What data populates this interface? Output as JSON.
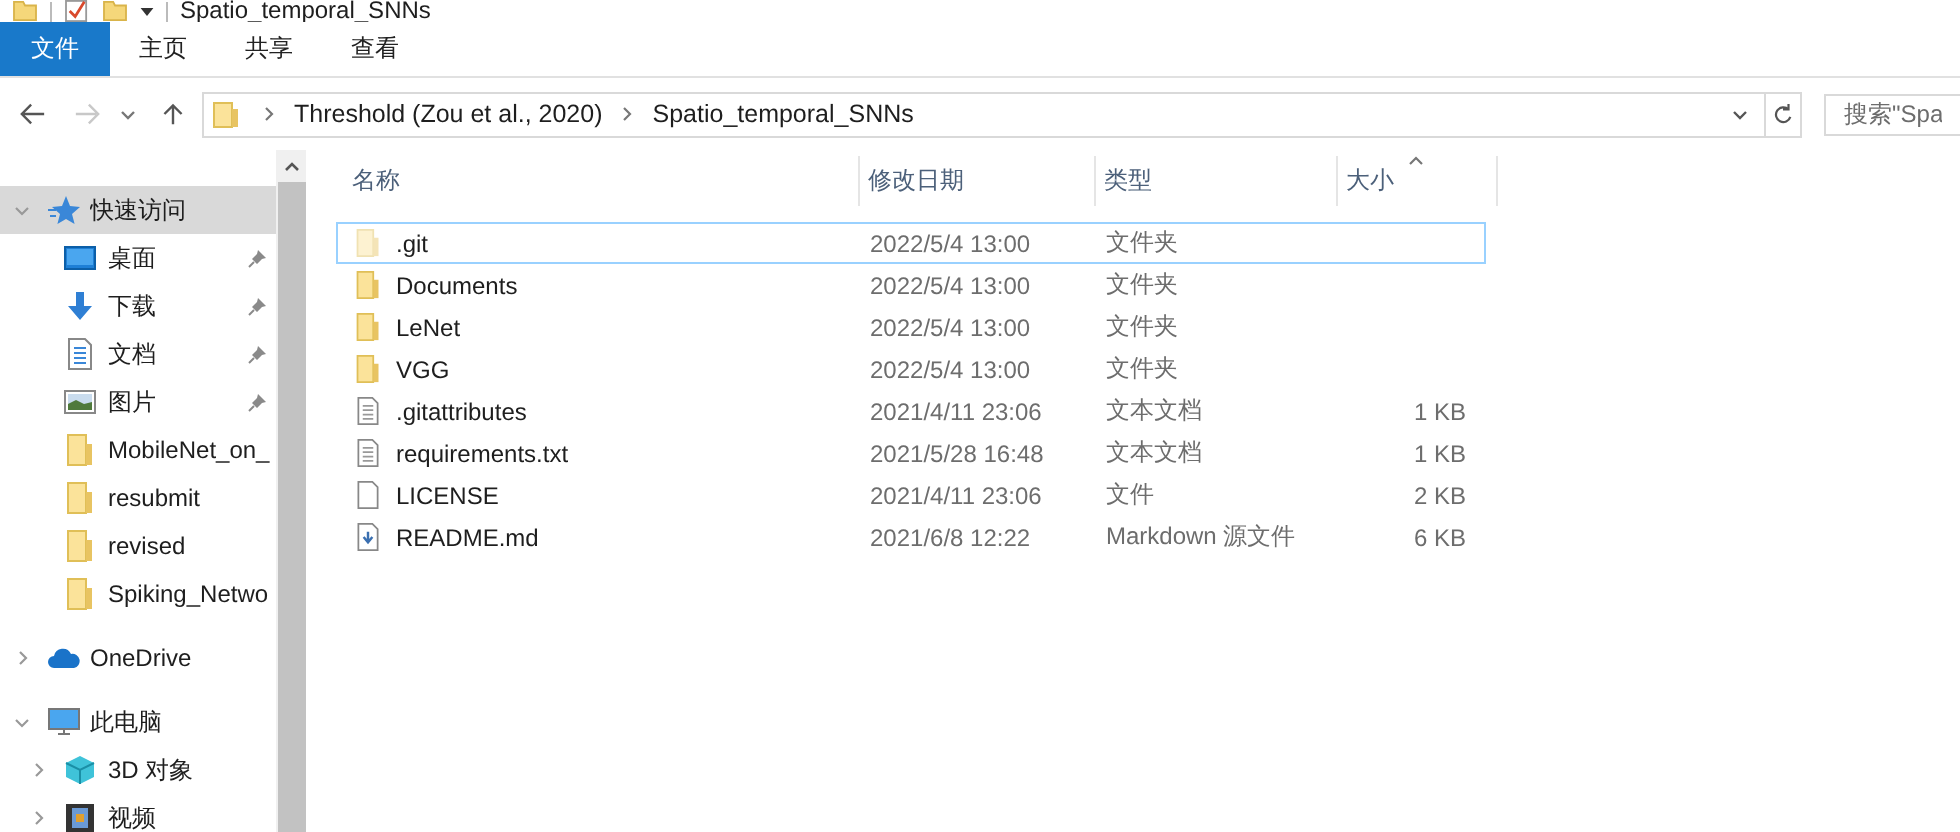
{
  "title_bar": {
    "title": "Spatio_temporal_SNNs"
  },
  "ribbon_tabs": [
    {
      "label": "文件",
      "selected": true
    },
    {
      "label": "主页",
      "selected": false
    },
    {
      "label": "共享",
      "selected": false
    },
    {
      "label": "查看",
      "selected": false
    }
  ],
  "nav": {
    "back_enabled": true,
    "forward_enabled": false
  },
  "address_bar": {
    "crumbs": [
      "Threshold (Zou et al., 2020)",
      "Spatio_temporal_SNNs"
    ]
  },
  "search": {
    "placeholder": "搜索\"Spa"
  },
  "sidebar": [
    {
      "label": "快速访问",
      "kind": "star",
      "expanded": true,
      "selected": true,
      "children": [
        {
          "label": "桌面",
          "kind": "desktop",
          "pinned": true,
          "selected": false
        },
        {
          "label": "下载",
          "kind": "download",
          "pinned": true,
          "selected": false
        },
        {
          "label": "文档",
          "kind": "document",
          "pinned": true,
          "selected": false
        },
        {
          "label": "图片",
          "kind": "image",
          "pinned": true,
          "selected": false
        },
        {
          "label": "MobileNet_on_",
          "kind": "folder",
          "pinned": false,
          "selected": false
        },
        {
          "label": "resubmit",
          "kind": "folder",
          "pinned": false,
          "selected": false
        },
        {
          "label": "revised",
          "kind": "folder",
          "pinned": false,
          "selected": false
        },
        {
          "label": "Spiking_Netwo",
          "kind": "folder",
          "pinned": false,
          "selected": false
        }
      ]
    },
    {
      "label": "OneDrive",
      "kind": "cloud",
      "expanded": false,
      "selected": false
    },
    {
      "label": "此电脑",
      "kind": "computer",
      "expanded": true,
      "selected": false,
      "children": [
        {
          "label": "3D 对象",
          "kind": "cube",
          "expanded": false,
          "selected": false
        },
        {
          "label": "视频",
          "kind": "video",
          "expanded": false,
          "selected": false
        }
      ]
    }
  ],
  "columns": [
    "名称",
    "修改日期",
    "类型",
    "大小"
  ],
  "files": [
    {
      "name": ".git",
      "kind": "folder",
      "hidden": true,
      "selected": true,
      "modified": "2022/5/4 13:00",
      "type": "文件夹"
    },
    {
      "name": "Documents",
      "kind": "folder",
      "hidden": false,
      "selected": false,
      "modified": "2022/5/4 13:00",
      "type": "文件夹"
    },
    {
      "name": "LeNet",
      "kind": "folder",
      "hidden": false,
      "selected": false,
      "modified": "2022/5/4 13:00",
      "type": "文件夹"
    },
    {
      "name": "VGG",
      "kind": "folder",
      "hidden": false,
      "selected": false,
      "modified": "2022/5/4 13:00",
      "type": "文件夹"
    },
    {
      "name": ".gitattributes",
      "kind": "text",
      "hidden": false,
      "selected": false,
      "modified": "2021/4/11 23:06",
      "type": "文本文档",
      "size": "1 KB"
    },
    {
      "name": "requirements.txt",
      "kind": "text",
      "hidden": false,
      "selected": false,
      "modified": "2021/5/28 16:48",
      "type": "文本文档",
      "size": "1 KB"
    },
    {
      "name": "LICENSE",
      "kind": "blank",
      "hidden": false,
      "selected": false,
      "modified": "2021/4/11 23:06",
      "type": "文件",
      "size": "2 KB"
    },
    {
      "name": "README.md",
      "kind": "markdown",
      "hidden": false,
      "selected": false,
      "modified": "2021/6/8 12:22",
      "type": "Markdown 源文件",
      "size": "6 KB"
    }
  ]
}
